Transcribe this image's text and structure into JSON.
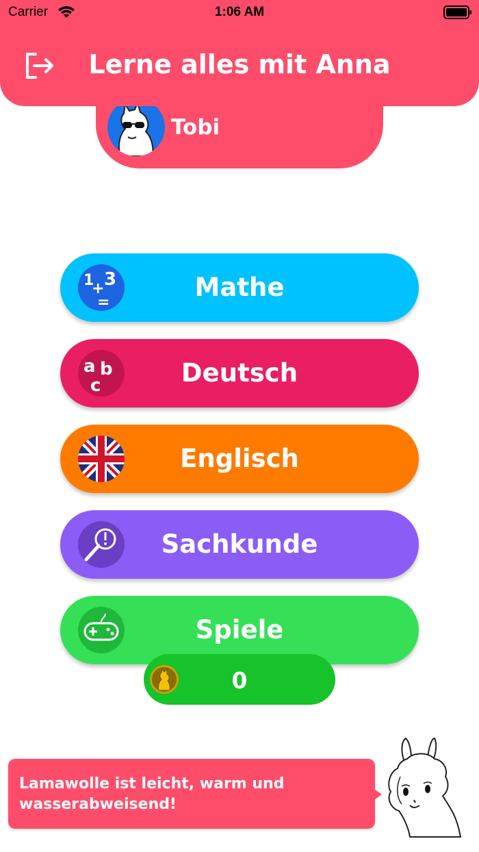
{
  "status_bar": {
    "carrier": "Carrier",
    "time": "1:06 AM"
  },
  "header": {
    "title": "Lerne alles mit Anna",
    "logout_icon": "logout-icon",
    "color": "#fe4d6b"
  },
  "user": {
    "name": "Tobi",
    "avatar_icon": "llama-sunglasses-avatar"
  },
  "subjects": [
    {
      "label": "Mathe",
      "icon": "numbers-icon",
      "color": "#00c2ff"
    },
    {
      "label": "Deutsch",
      "icon": "abc-icon",
      "color": "#e91e63"
    },
    {
      "label": "Englisch",
      "icon": "uk-flag-icon",
      "color": "#ff7b00"
    },
    {
      "label": "Sachkunde",
      "icon": "magnifier-icon",
      "color": "#8c5cf7"
    },
    {
      "label": "Spiele",
      "icon": "gamepad-icon",
      "color": "#35e057"
    }
  ],
  "coins": {
    "count": "0",
    "icon": "llama-coin-icon",
    "color": "#16c32b"
  },
  "tip": {
    "text": "Lamawolle ist leicht, warm und wasserabweisend!"
  },
  "mascot": {
    "icon": "llama-mascot"
  }
}
